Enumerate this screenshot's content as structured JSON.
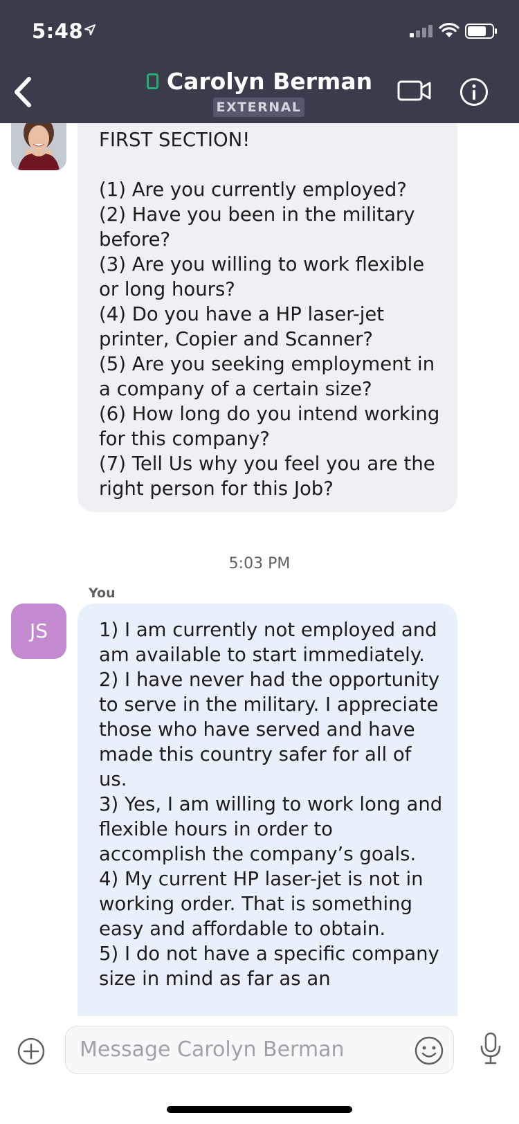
{
  "status_bar": {
    "time": "5:48"
  },
  "header": {
    "contact_name": "Carolyn Berman",
    "badge": "EXTERNAL"
  },
  "messages": [
    {
      "from": "Carolyn Berman",
      "text": "FIRST SECTION!\n\n(1) Are you currently employed?\n(2) Have you been in the military before?\n(3) Are you willing to work flexible or long hours?\n(4) Do you have a HP laser-jet printer, Copier and Scanner?\n(5) Are you seeking employment in a company of a certain size?\n(6) How long do you intend working for this company?\n(7) Tell Us why you feel you are the right person for this Job?"
    },
    {
      "timestamp": "5:03 PM",
      "sender_label": "You",
      "avatar_initials": "JS",
      "text": "1) I am currently not employed and am available to start immediately.\n2) I have never had the opportunity to serve in the military. I appreciate those who have served and have made this country safer for all of us.\n3) Yes, I am willing to work long and flexible hours in order to accomplish the company’s goals.\n4) My current HP laser-jet is not in working order. That is something easy and affordable to obtain.\n5) I do not have a specific company size in mind as far as an"
    }
  ],
  "composer": {
    "placeholder": "Message Carolyn Berman"
  },
  "colors": {
    "header_bg": "#3a3c4c",
    "presence_green": "#2bac76",
    "incoming_bubble": "#efeff4",
    "outgoing_bubble": "#e8f0fc",
    "avatar_js": "#c38ad0"
  }
}
